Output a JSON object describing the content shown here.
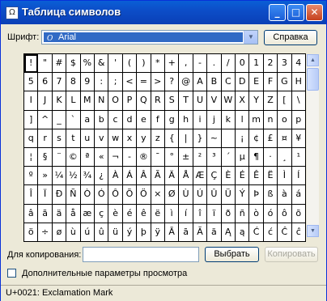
{
  "window": {
    "title": "Таблица символов",
    "icon_glyph": "Ω"
  },
  "controls": {
    "minimize_glyph": "_",
    "maximize_glyph": "□",
    "close_glyph": "✕"
  },
  "font": {
    "label": "Шрифт:",
    "selected": "Arial",
    "icon_glyph": "O"
  },
  "help_button": "Справка",
  "grid": {
    "rows": [
      [
        "!",
        "\"",
        "#",
        "$",
        "%",
        "&",
        "'",
        "(",
        ")",
        "*",
        "+",
        ",",
        "-",
        ".",
        "/",
        "0",
        "1",
        "2",
        "3",
        "4"
      ],
      [
        "5",
        "6",
        "7",
        "8",
        "9",
        ":",
        ";",
        "<",
        "=",
        ">",
        "?",
        "@",
        "A",
        "B",
        "C",
        "D",
        "E",
        "F",
        "G",
        "H"
      ],
      [
        "I",
        "J",
        "K",
        "L",
        "M",
        "N",
        "O",
        "P",
        "Q",
        "R",
        "S",
        "T",
        "U",
        "V",
        "W",
        "X",
        "Y",
        "Z",
        "[",
        "\\"
      ],
      [
        "]",
        "^",
        "_",
        "`",
        "a",
        "b",
        "c",
        "d",
        "e",
        "f",
        "g",
        "h",
        "i",
        "j",
        "k",
        "l",
        "m",
        "n",
        "o",
        "p"
      ],
      [
        "q",
        "r",
        "s",
        "t",
        "u",
        "v",
        "w",
        "x",
        "y",
        "z",
        "{",
        "|",
        "}",
        "~",
        " ",
        "¡",
        "¢",
        "£",
        "¤",
        "¥"
      ],
      [
        "¦",
        "§",
        "¨",
        "©",
        "ª",
        "«",
        "¬",
        "-",
        "®",
        "¯",
        "°",
        "±",
        "²",
        "³",
        "´",
        "µ",
        "¶",
        "·",
        "¸",
        "¹"
      ],
      [
        "º",
        "»",
        "¼",
        "½",
        "¾",
        "¿",
        "À",
        "Á",
        "Â",
        "Ã",
        "Ä",
        "Å",
        "Æ",
        "Ç",
        "È",
        "É",
        "Ê",
        "Ë",
        "Ì",
        "Í"
      ],
      [
        "Î",
        "Ï",
        "Ð",
        "Ñ",
        "Ò",
        "Ó",
        "Ô",
        "Õ",
        "Ö",
        "×",
        "Ø",
        "Ù",
        "Ú",
        "Û",
        "Ü",
        "Ý",
        "Þ",
        "ß",
        "à",
        "á"
      ],
      [
        "â",
        "ã",
        "ä",
        "å",
        "æ",
        "ç",
        "è",
        "é",
        "ê",
        "ë",
        "ì",
        "í",
        "î",
        "ï",
        "ð",
        "ñ",
        "ò",
        "ó",
        "ô",
        "õ"
      ],
      [
        "ö",
        "÷",
        "ø",
        "ù",
        "ú",
        "û",
        "ü",
        "ý",
        "þ",
        "ÿ",
        "Ā",
        "ā",
        "Ă",
        "ă",
        "Ą",
        "ą",
        "Ć",
        "ć",
        "Ĉ",
        "ĉ"
      ]
    ],
    "selected_char": "!"
  },
  "scrollbar": {
    "up_glyph": "▲",
    "down_glyph": "▼"
  },
  "copy": {
    "label": "Для копирования:",
    "value": "",
    "select_button": "Выбрать",
    "copy_button": "Копировать"
  },
  "advanced": {
    "label": "Дополнительные параметры просмотра",
    "checked": false
  },
  "status": "U+0021: Exclamation Mark"
}
